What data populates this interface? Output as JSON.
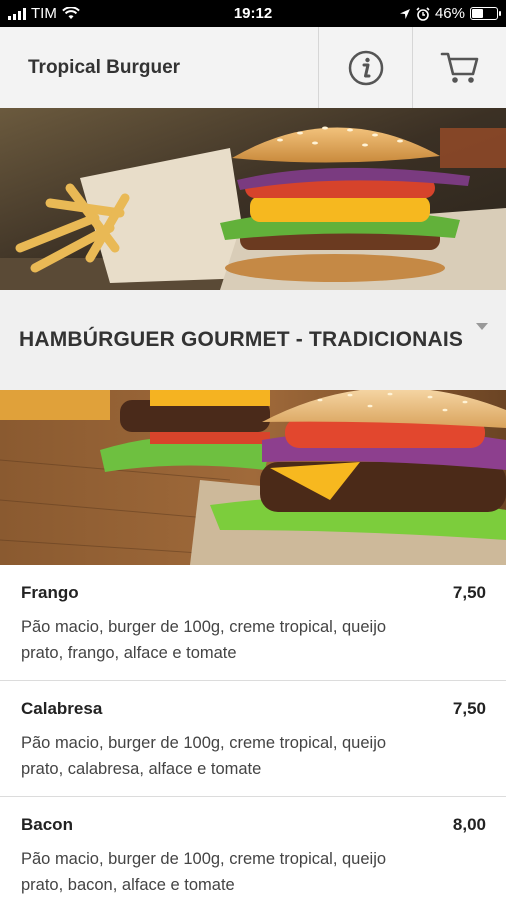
{
  "status_bar": {
    "carrier": "TIM",
    "time": "19:12",
    "battery_percent": "46%",
    "battery_level": 0.46
  },
  "header": {
    "title": "Tropical Burguer",
    "info_icon": "info-icon",
    "cart_icon": "cart-icon"
  },
  "category": {
    "title": "HAMBÚRGUER GOURMET - TRADICIONAIS",
    "dropdown_icon": "caret-down-icon"
  },
  "menu": {
    "items": [
      {
        "name": "Frango",
        "price": "7,50",
        "description": "Pão macio, burger de 100g, creme tropical, queijo prato, frango, alface e tomate"
      },
      {
        "name": "Calabresa",
        "price": "7,50",
        "description": "Pão macio, burger de 100g, creme tropical, queijo prato, calabresa, alface e tomate"
      },
      {
        "name": "Bacon",
        "price": "8,00",
        "description": "Pão macio, burger de 100g, creme tropical, queijo prato, bacon, alface e tomate"
      }
    ]
  },
  "colors": {
    "header_bg": "#f2f2f2",
    "category_bg": "#f0f0f0",
    "text": "#222222"
  }
}
